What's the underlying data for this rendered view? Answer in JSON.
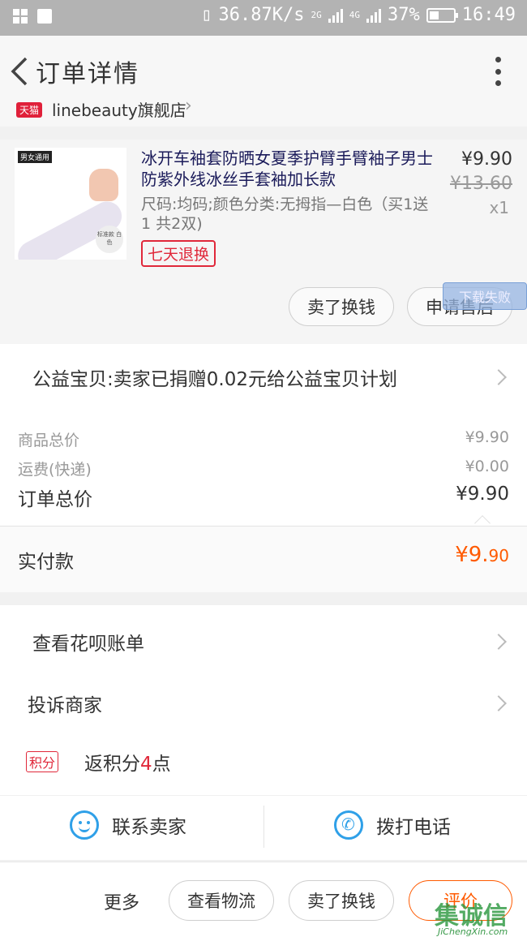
{
  "status_bar": {
    "speed": "36.87K/s",
    "net1": "2G",
    "net2": "4G",
    "battery": "37%",
    "time": "16:49"
  },
  "header": {
    "title": "订单详情"
  },
  "store": {
    "badge": "天猫",
    "name": "linebeauty旗舰店"
  },
  "product": {
    "image_tag": "男女通用",
    "image_badge": "标准款 白色",
    "title": "冰开车袖套防晒女夏季护臂手臂袖子男士防紫外线冰丝手套袖加长款",
    "attrs": "尺码:均码;颜色分类:无拇指—白色（买1送1 共2双)",
    "return_badge": "七天退换",
    "price": "¥9.90",
    "original_price": "¥13.60",
    "quantity": "x1",
    "btn_sell": "卖了换钱",
    "btn_after_sale": "申请售后",
    "download_fail": "下载失败"
  },
  "charity": {
    "text": "公益宝贝:卖家已捐赠0.02元给公益宝贝计划"
  },
  "totals": {
    "goods_label": "商品总价",
    "goods_value": "¥9.90",
    "shipping_label": "运费(快递)",
    "shipping_value": "¥0.00",
    "order_label": "订单总价",
    "order_value": "¥9.90",
    "paid_label": "实付款",
    "paid_main": "¥9.",
    "paid_cents": "90"
  },
  "links": {
    "huabei": "查看花呗账单",
    "complain": "投诉商家",
    "points_badge": "积分",
    "points_prefix": "返积分",
    "points_num": "4",
    "points_suffix": "点"
  },
  "contact": {
    "seller": "联系卖家",
    "call": "拨打电话"
  },
  "actions": {
    "more": "更多",
    "logistics": "查看物流",
    "sell": "卖了换钱",
    "review": "评价"
  },
  "watermark": {
    "text": "集诚信",
    "url": "JiChengXin.com"
  },
  "colors": {
    "accent": "#ff5a00",
    "tmall_red": "#e0283a",
    "icon_blue": "#2fa0e8"
  }
}
